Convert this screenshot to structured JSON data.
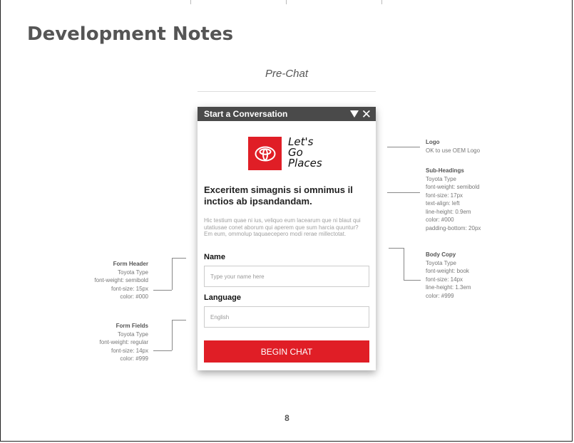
{
  "document": {
    "title": "Development Notes",
    "section": "Pre-Chat",
    "page_number": "8"
  },
  "chat": {
    "header_title": "Start a Conversation",
    "minimize_icon": "triangle-down-icon",
    "close_icon": "close-icon",
    "logo_icon": "toyota-logo-icon",
    "tagline": [
      "Let's",
      "Go",
      "Places"
    ],
    "subheading": "Exceritem simagnis si omnimus il inctios ab ipsandandam.",
    "body_copy": [
      "Hic testium quae ni ius, veliquo eum lacearum que ni blaut qui utatiusae conet aborum qui aperem que sum harcia quuntur?",
      "Em eum, ommolup taquaecepero modi rerae millectotat."
    ],
    "name_label": "Name",
    "name_placeholder": "Type your name here",
    "language_label": "Language",
    "language_value": "English",
    "begin_button": "BEGIN CHAT"
  },
  "annotations": {
    "logo": {
      "title": "Logo",
      "lines": [
        "OK to use OEM Logo"
      ]
    },
    "sub_headings": {
      "title": "Sub-Headings",
      "lines": [
        "Toyota Type",
        "font-weight: semibold",
        "font-size: 17px",
        "text-align: left",
        "line-height: 0.9em",
        "color: #000",
        "padding-bottom: 20px"
      ]
    },
    "body_copy": {
      "title": "Body Copy",
      "lines": [
        "Toyota Type",
        "font-weight: book",
        "font-size: 14px",
        "line-height: 1.3em",
        "color: #999"
      ]
    },
    "form_header": {
      "title": "Form Header",
      "lines": [
        "Toyota Type",
        "font-weight: semibold",
        "font-size: 15px",
        "color: #000"
      ]
    },
    "form_fields": {
      "title": "Form Fields",
      "lines": [
        "Toyota Type",
        "font-weight: regular",
        "font-size: 14px",
        "color: #999"
      ]
    }
  },
  "colors": {
    "brand_red": "#e01e26",
    "header_gray": "#4a4a4a"
  }
}
